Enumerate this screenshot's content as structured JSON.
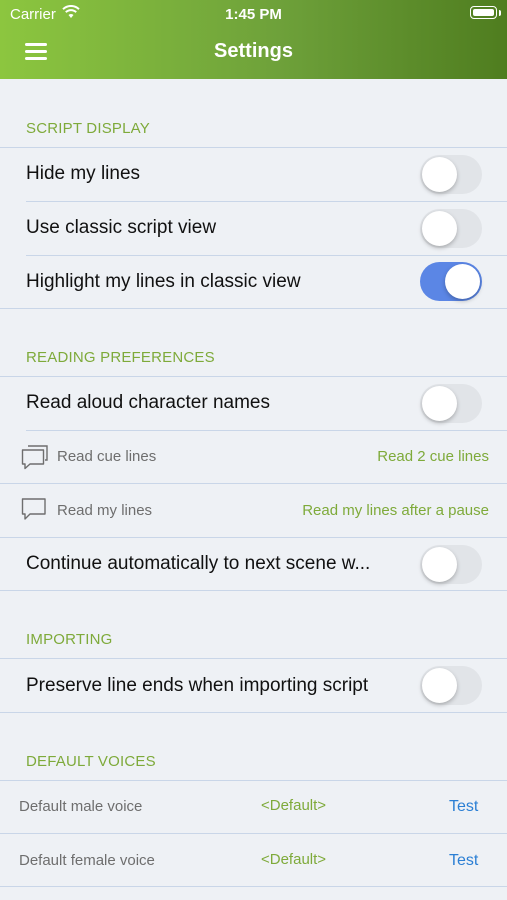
{
  "status_bar": {
    "carrier": "Carrier",
    "time": "1:45 PM"
  },
  "nav": {
    "title": "Settings",
    "menu_icon": "hamburger-icon"
  },
  "colors": {
    "header_start": "#8cc63f",
    "header_end": "#4f7d1f",
    "accent_green": "#7eaa3a",
    "toggle_on": "#5b86e5",
    "link_blue": "#2b7fd4"
  },
  "script_display": {
    "header": "SCRIPT DISPLAY",
    "hide_lines": {
      "label": "Hide my lines",
      "on": false
    },
    "classic_view": {
      "label": "Use classic script view",
      "on": false
    },
    "highlight": {
      "label": "Highlight my lines in classic view",
      "on": true
    }
  },
  "reading": {
    "header": "READING PREFERENCES",
    "read_names": {
      "label": "Read aloud character names",
      "on": false
    },
    "cue_lines": {
      "label": "Read cue lines",
      "value": "Read 2 cue lines",
      "icon": "double-speech-bubble-icon"
    },
    "my_lines": {
      "label": "Read my lines",
      "value": "Read my lines after a pause",
      "icon": "speech-bubble-icon"
    },
    "continue": {
      "label": "Continue automatically to next scene w...",
      "on": false
    }
  },
  "importing": {
    "header": "IMPORTING",
    "preserve": {
      "label": "Preserve line ends when importing script",
      "on": false
    }
  },
  "voices": {
    "header": "DEFAULT VOICES",
    "male": {
      "label": "Default male voice",
      "value": "<Default>",
      "test": "Test"
    },
    "female": {
      "label": "Default female voice",
      "value": "<Default>",
      "test": "Test"
    }
  }
}
